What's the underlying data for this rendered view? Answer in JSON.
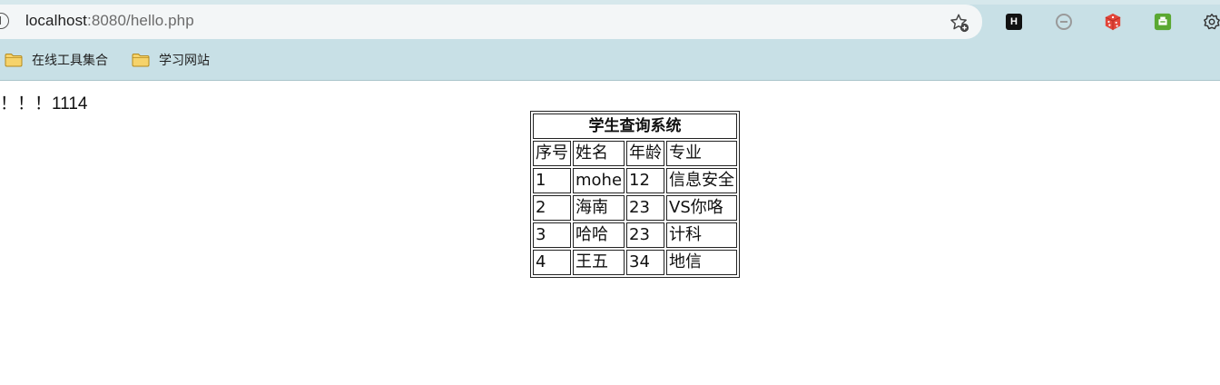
{
  "browser": {
    "url_host": "localhost",
    "url_rest": ":8080/hello.php",
    "bookmarks": [
      {
        "label": "在线工具集合"
      },
      {
        "label": "学习网站"
      }
    ],
    "extensions": [
      "H"
    ]
  },
  "page": {
    "text": "！！！1114"
  },
  "table": {
    "title": "学生查询系统",
    "headers": [
      "序号",
      "姓名",
      "年龄",
      "专业"
    ],
    "rows": [
      [
        "1",
        "mohe",
        "12",
        "信息安全"
      ],
      [
        "2",
        "海南",
        "23",
        "VS你咯"
      ],
      [
        "3",
        "哈哈",
        "23",
        "计科"
      ],
      [
        "4",
        "王五",
        "34",
        "地信"
      ]
    ]
  }
}
